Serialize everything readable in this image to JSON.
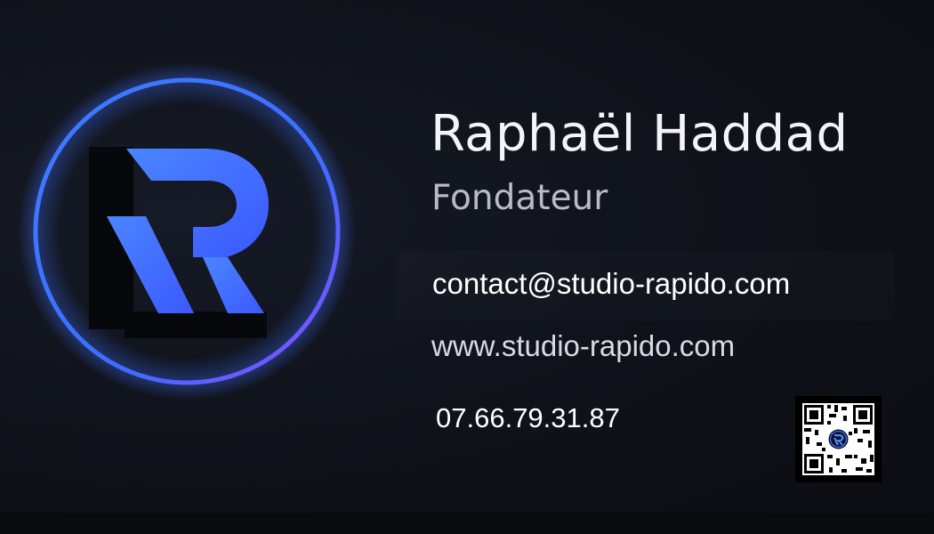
{
  "person": {
    "name": "Raphaël Haddad",
    "role": "Fondateur"
  },
  "contact": {
    "email": "contact@studio-rapido.com",
    "website": "www.studio-rapido.com",
    "phone": "07.66.79.31.87"
  },
  "logo": {
    "icon": "r-monogram-icon"
  },
  "qr_code": {
    "icon": "qr-code-icon"
  },
  "colors": {
    "background": "#10131b",
    "ring_blue": "#3d7dff",
    "ring_violet": "#8a4dff",
    "letter_blue": "#3f73ff",
    "text": "#ffffff",
    "muted_text": "#b9bcc4"
  }
}
